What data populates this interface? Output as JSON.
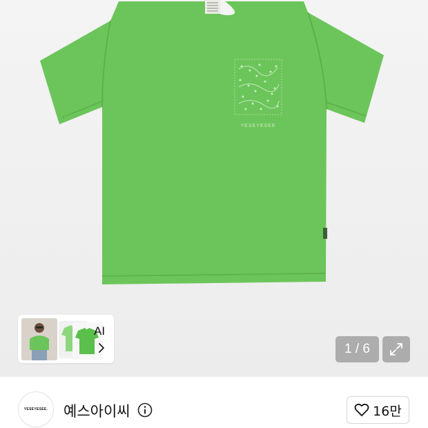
{
  "product": {
    "shirt_color": "#6cc55a",
    "print_text": "YESEYESEE",
    "icon": "tshirt-image"
  },
  "ai_panel": {
    "label": "AI",
    "icon": "chevron-right-icon"
  },
  "gallery": {
    "counter": "1 / 6",
    "current": 1,
    "total": 6,
    "expand_icon": "expand-icon"
  },
  "brand": {
    "name": "예스아이씨",
    "logo_text": "YESEYESEE.",
    "info_icon": "info-icon"
  },
  "like": {
    "count": "16만",
    "icon": "heart-icon"
  },
  "colors": {
    "shirt_green": "#6cc55a",
    "hero_bg": "#efefef",
    "overlay": "#787878"
  }
}
